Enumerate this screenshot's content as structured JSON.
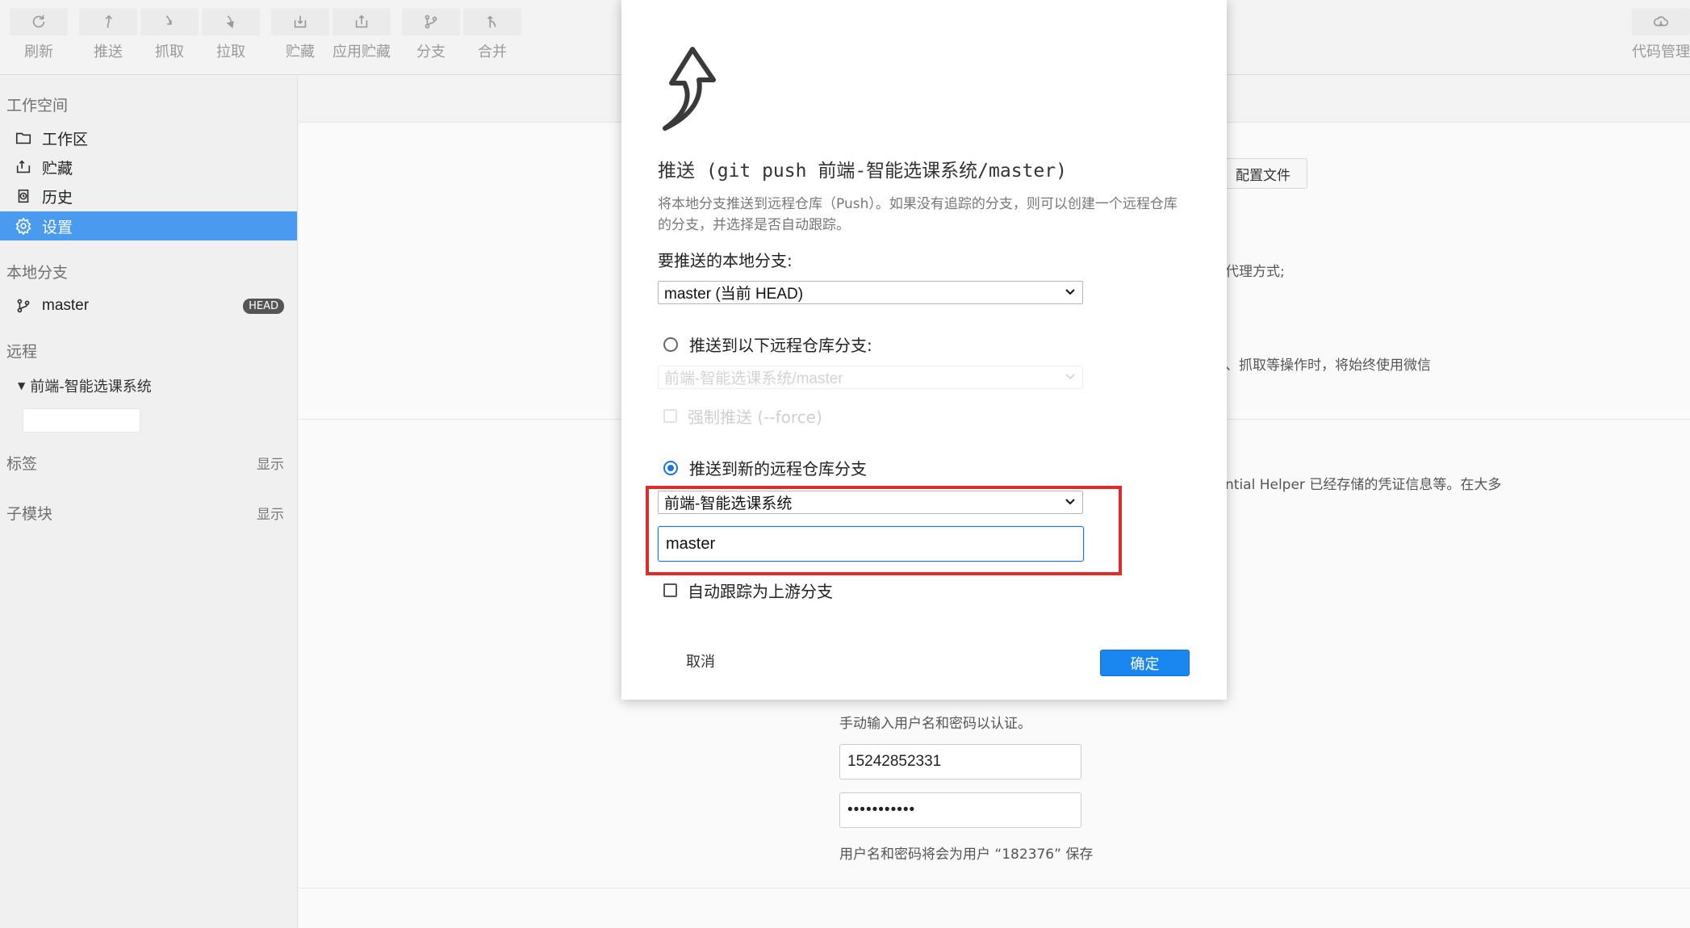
{
  "toolbar": {
    "buttons": [
      {
        "label": "刷新",
        "icon": "refresh-icon"
      },
      {
        "label": "推送",
        "icon": "push-icon"
      },
      {
        "label": "抓取",
        "icon": "fetch-icon"
      },
      {
        "label": "拉取",
        "icon": "pull-icon"
      },
      {
        "label": "贮藏",
        "icon": "stash-icon"
      },
      {
        "label": "应用贮藏",
        "icon": "apply-stash-icon"
      },
      {
        "label": "分支",
        "icon": "branch-icon"
      },
      {
        "label": "合并",
        "icon": "merge-icon"
      },
      {
        "label": "代码管理",
        "icon": "cloud-icon"
      }
    ]
  },
  "sidebar": {
    "workspace_title": "工作空间",
    "items": [
      {
        "label": "工作区",
        "icon": "folder-icon"
      },
      {
        "label": "贮藏",
        "icon": "stash-icon"
      },
      {
        "label": "历史",
        "icon": "history-icon"
      },
      {
        "label": "设置",
        "icon": "gear-icon"
      }
    ],
    "local_branches_title": "本地分支",
    "branch": {
      "name": "master",
      "badge": "HEAD"
    },
    "remote_title": "远程",
    "remote_name": "前端-智能选课系统",
    "tags_title": "标签",
    "tags_show": "显示",
    "submodules_title": "子模块",
    "submodules_show": "显示"
  },
  "background": {
    "config_button": "配置文件",
    "proxy_text": "代理方式;",
    "fetch_text": "、抓取等操作时，将始终使用微信",
    "credential_text": "ntial Helper 已经存储的凭证信息等。在大多",
    "manual_text": "手动输入用户名和密码以认证。",
    "username_value": "15242852331",
    "password_value": "•••••••••••",
    "save_note": "用户名和密码将会为用户 “182376” 保存"
  },
  "dialog": {
    "title": "推送 (git push 前端-智能选课系统/master)",
    "description": "将本地分支推送到远程仓库（Push）。如果没有追踪的分支，则可以创建一个远程仓库的分支，并选择是否自动跟踪。",
    "local_branch_label": "要推送的本地分支:",
    "local_branch_value": "master (当前 HEAD)",
    "push_existing_label": "推送到以下远程仓库分支:",
    "existing_remote_value": "前端-智能选课系统/master",
    "force_label": "强制推送 (--force)",
    "push_new_label": "推送到新的远程仓库分支",
    "new_remote_value": "前端-智能选课系统",
    "new_branch_value": "master",
    "track_label": "自动跟踪为上游分支",
    "cancel_label": "取消",
    "ok_label": "确定"
  },
  "colors": {
    "accent": "#4a9bf0",
    "primary_button": "#1a87f0",
    "highlight_box": "#e22a2a"
  }
}
